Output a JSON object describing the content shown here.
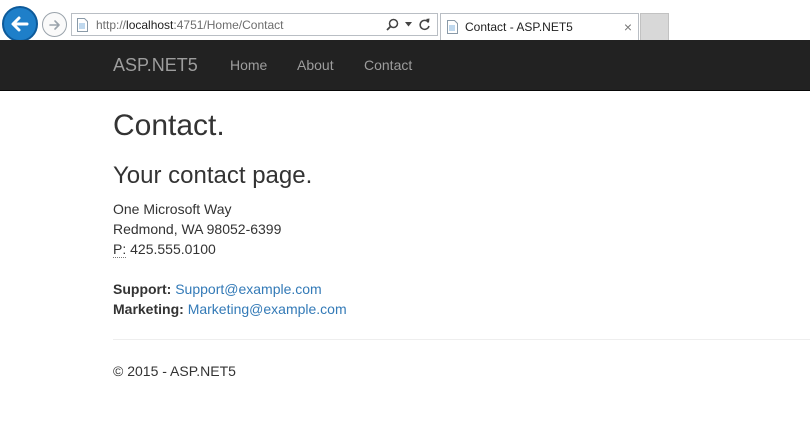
{
  "browser": {
    "url_prefix": "http://",
    "url_host": "localhost",
    "url_rest": ":4751/Home/Contact",
    "tab_title": "Contact - ASP.NET5",
    "tab_close": "×"
  },
  "navbar": {
    "brand": "ASP.NET5",
    "links": [
      "Home",
      "About",
      "Contact"
    ]
  },
  "page": {
    "title": "Contact.",
    "subtitle": "Your contact page.",
    "address": [
      "One Microsoft Way",
      "Redmond, WA 98052-6399"
    ],
    "phone_label": "P:",
    "phone_number": "425.555.0100",
    "support_label": "Support:",
    "support_email": "Support@example.com",
    "marketing_label": "Marketing:",
    "marketing_email": "Marketing@example.com"
  },
  "footer": {
    "text": "© 2015 - ASP.NET5"
  },
  "colors": {
    "navbar_bg": "#222222",
    "nav_text": "#9d9d9d",
    "link": "#337ab7",
    "back_button": "#1e7fc9"
  }
}
